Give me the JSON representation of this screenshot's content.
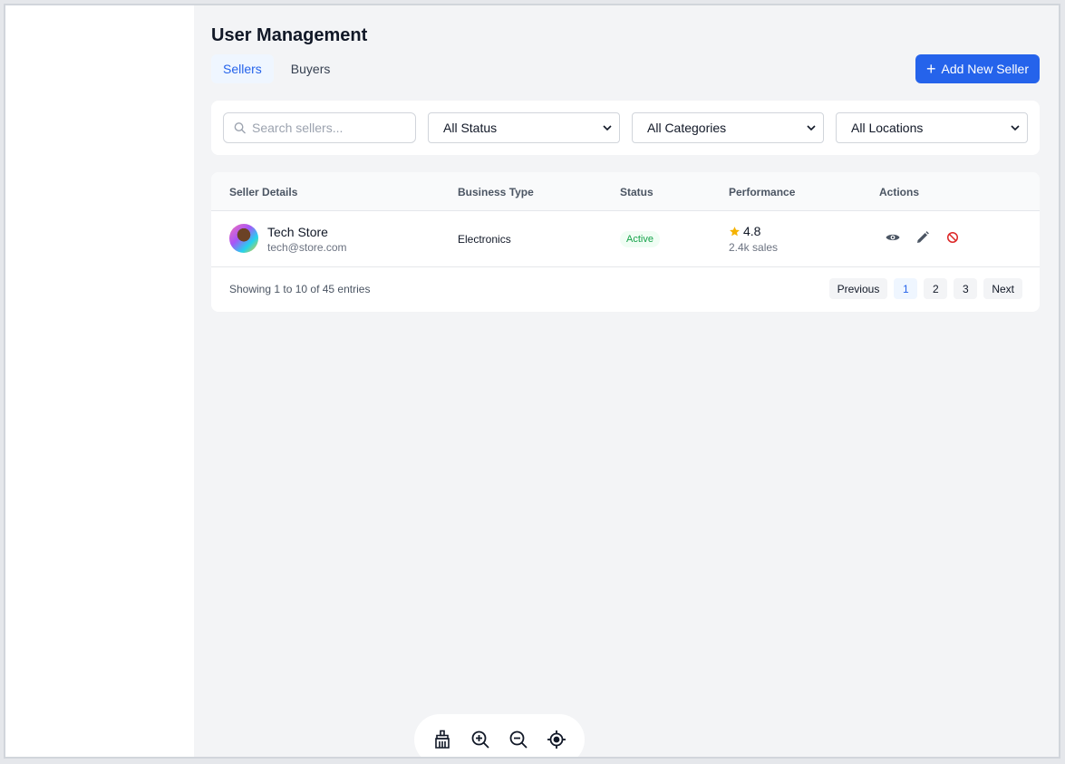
{
  "page": {
    "title": "User Management"
  },
  "tabs": [
    {
      "label": "Sellers",
      "active": true
    },
    {
      "label": "Buyers",
      "active": false
    }
  ],
  "add_button": {
    "label": "Add New Seller",
    "icon": "plus-icon"
  },
  "filters": {
    "search_placeholder": "Search sellers...",
    "status": "All Status",
    "categories": "All Categories",
    "locations": "All Locations"
  },
  "table": {
    "columns": [
      "Seller Details",
      "Business Type",
      "Status",
      "Performance",
      "Actions"
    ],
    "rows": [
      {
        "name": "Tech Store",
        "email": "tech@store.com",
        "business_type": "Electronics",
        "status": "Active",
        "rating": "4.8",
        "sales": "2.4k sales"
      }
    ],
    "entries_text": "Showing 1 to 10 of 45 entries",
    "pagination": {
      "previous": "Previous",
      "pages": [
        "1",
        "2",
        "3"
      ],
      "current": "1",
      "next": "Next"
    }
  },
  "toolbar": {
    "icons": [
      "broom-icon",
      "zoom-in-icon",
      "zoom-out-icon",
      "locate-icon"
    ]
  },
  "colors": {
    "accent": "#2563eb",
    "status_active": "#16a34a",
    "star": "#f5b301",
    "block": "#dc2626"
  }
}
